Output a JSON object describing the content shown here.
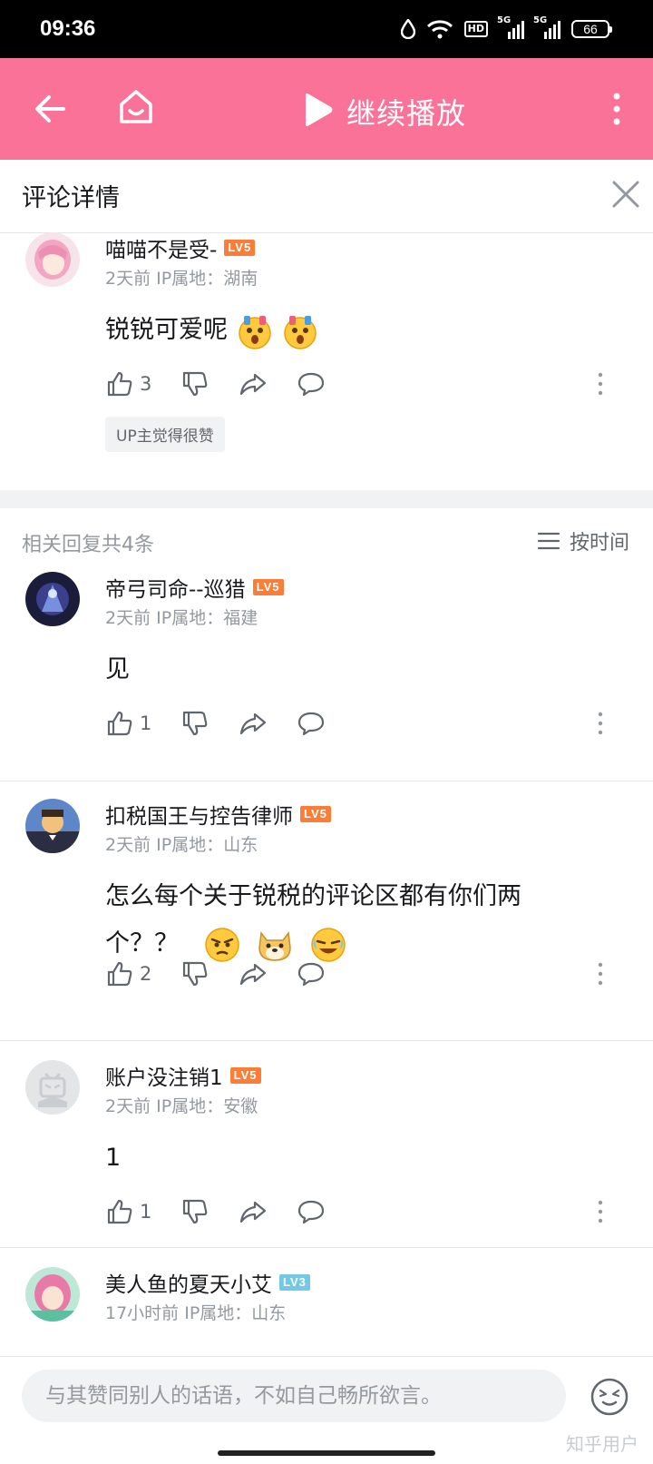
{
  "status": {
    "time": "09:36",
    "hd": "HD",
    "net1": "5G",
    "net2": "5G",
    "battery": "66"
  },
  "topbar": {
    "play_label": "继续播放"
  },
  "header": {
    "title": "评论详情"
  },
  "main_comment": {
    "user": "喵喵不是受-",
    "level": "LV5",
    "meta": "2天前 IP属地：湖南",
    "text": "锐锐可爱呢",
    "likes": "3",
    "tag": "UP主觉得很赞"
  },
  "replies_header": {
    "count": "相关回复共4条",
    "sort": "按时间"
  },
  "replies": [
    {
      "user": "帝弓司命--巡猎",
      "level": "LV5",
      "meta": "2天前 IP属地：福建",
      "text": "见",
      "likes": "1"
    },
    {
      "user": "扣税国王与控告律师",
      "level": "LV5",
      "meta": "2天前 IP属地：山东",
      "text1": "怎么每个关于锐税的评论区都有你们两",
      "text2": "个？？",
      "likes": "2"
    },
    {
      "user": "账户没注销1",
      "level": "LV5",
      "meta": "2天前 IP属地：安徽",
      "text": "1",
      "likes": "1"
    },
    {
      "user": "美人鱼的夏天小艾",
      "level": "LV3",
      "meta": "17小时前 IP属地：山东"
    }
  ],
  "footer": {
    "placeholder": "与其赞同别人的话语，不如自己畅所欲言。",
    "watermark": "知乎用户"
  },
  "colors": {
    "brand": "#fb7299",
    "lv5": "#fd7c36",
    "lv3": "#73c9e5"
  }
}
